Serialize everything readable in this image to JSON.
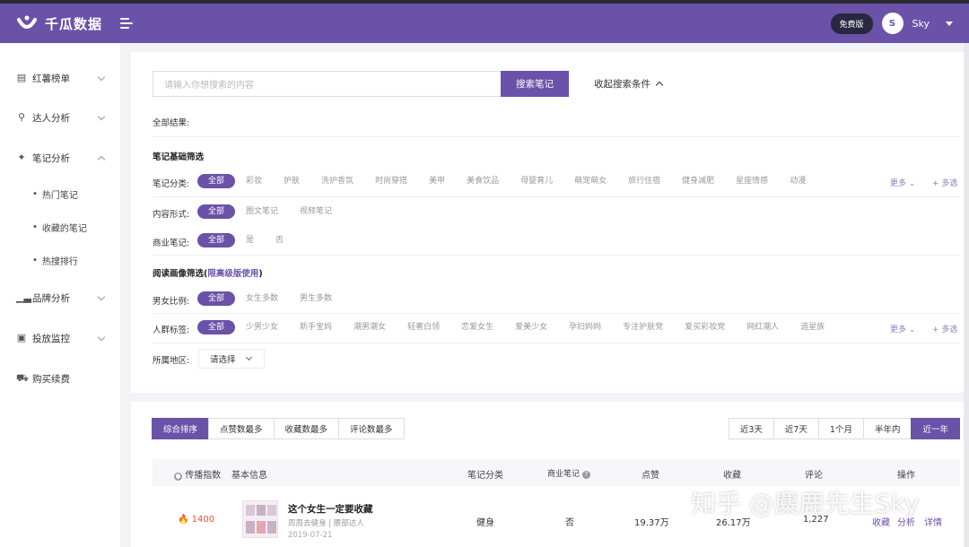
{
  "header": {
    "app_name": "千瓜数据",
    "free_badge": "免费版",
    "avatar_text": "S",
    "user_name": "Sky",
    "brand_color": "#6a52a8"
  },
  "sidebar": {
    "items": [
      {
        "label": "红薯榜单",
        "icon": "list-icon"
      },
      {
        "label": "达人分析",
        "icon": "search-icon"
      },
      {
        "label": "笔记分析",
        "icon": "note-icon"
      },
      {
        "label": "品牌分析",
        "icon": "chart-icon"
      },
      {
        "label": "投放监控",
        "icon": "monitor-icon"
      },
      {
        "label": "购买续费",
        "icon": "cart-icon"
      }
    ],
    "sub_items": [
      "热门笔记",
      "收藏的笔记",
      "热搜排行"
    ]
  },
  "search": {
    "placeholder": "请输入你想搜索的内容",
    "button": "搜索笔记",
    "collapse": "收起搜索条件"
  },
  "filters": {
    "all_results": "全部结果:",
    "basic_title": "笔记基础筛选",
    "category_label": "笔记分类:",
    "categories": [
      "全部",
      "彩妆",
      "护肤",
      "洗护香氛",
      "时尚穿搭",
      "美甲",
      "美食饮品",
      "母婴育儿",
      "萌宠萌女",
      "旅行住宿",
      "健身减肥",
      "星座情感",
      "动漫"
    ],
    "content_label": "内容形式:",
    "content_forms": [
      "全部",
      "图文笔记",
      "视频笔记"
    ],
    "commercial_label": "商业笔记:",
    "commercial_options": [
      "全部",
      "是",
      "否"
    ],
    "portrait_title_a": "阅读画像筛选(",
    "portrait_title_b": "限高级版使用",
    "portrait_title_c": ")",
    "gender_label": "男女比例:",
    "gender_options": [
      "全部",
      "女生多数",
      "男生多数"
    ],
    "crowd_label": "人群标签:",
    "crowd_tags": [
      "全部",
      "少男少女",
      "新手宝妈",
      "潮男潮女",
      "轻奢白领",
      "恋爱女生",
      "爱美少女",
      "孕妇妈妈",
      "专注护肤党",
      "爱买彩妆党",
      "网红潮人",
      "追星族"
    ],
    "region_label": "所属地区:",
    "region_value": "请选择",
    "more": "更多",
    "multi": "+ 多选"
  },
  "sort": {
    "tabs": [
      "综合排序",
      "点赞数最多",
      "收藏数最多",
      "评论数最多"
    ],
    "time_tabs": [
      "近3天",
      "近7天",
      "1个月",
      "半年内",
      "近一年"
    ]
  },
  "table": {
    "headers": {
      "index": "传播指数",
      "basic": "基本信息",
      "category": "笔记分类",
      "commercial": "商业笔记",
      "likes": "点赞",
      "favorites": "收藏",
      "comments": "评论",
      "actions": "操作"
    },
    "rows": [
      {
        "index": "1400",
        "title": "这个女生一定要收藏",
        "meta": "周周去健身 | 腰部达人",
        "date": "2019-07-21",
        "category": "健身",
        "commercial": "否",
        "likes": "19.37万",
        "favorites": "26.17万",
        "comments": "1,227",
        "actions": [
          "收藏",
          "分析",
          "详情"
        ]
      }
    ]
  },
  "watermark": "知乎 @麋鹿先生Sky"
}
